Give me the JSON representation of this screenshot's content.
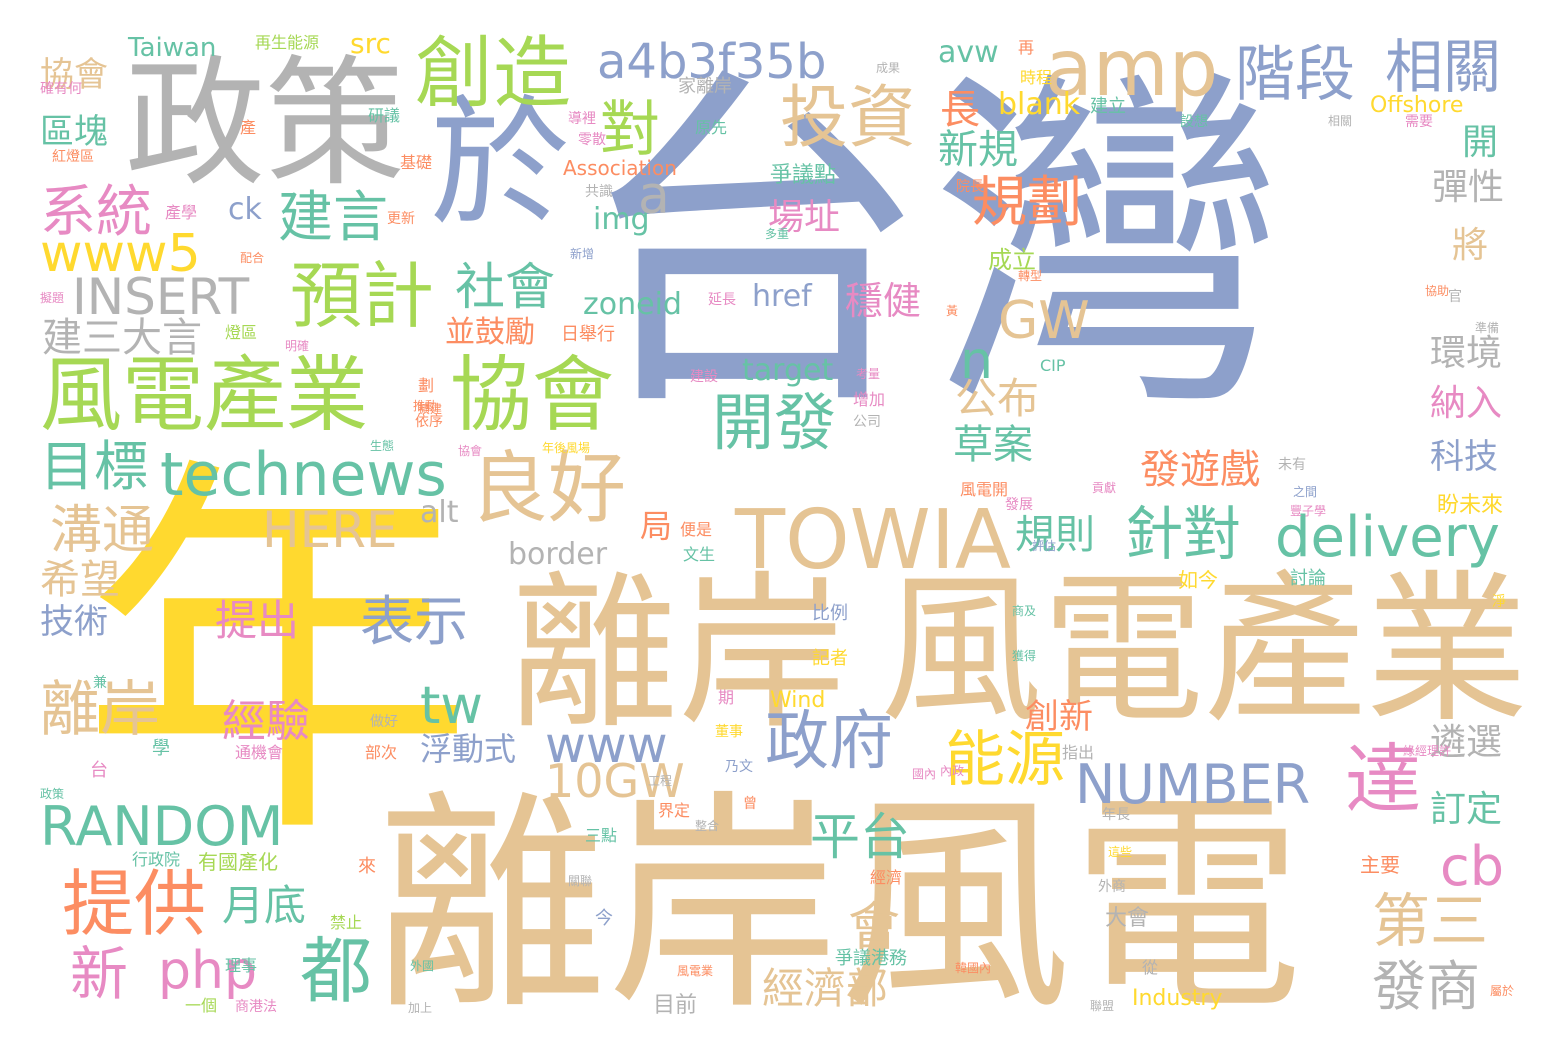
{
  "colors": {
    "background": "#ffffff",
    "yellow": "#ffd92f",
    "tan": "#e5c494",
    "blue": "#8da0cb",
    "gray": "#b3b3b3",
    "green": "#a6d854",
    "teal": "#66c2a5",
    "orange": "#fc8d62",
    "pink": "#e78ac3"
  },
  "words": [
    {
      "text": "台灣",
      "color": "blue"
    },
    {
      "text": "年",
      "color": "yellow"
    },
    {
      "text": "離岸風電",
      "color": "tan"
    },
    {
      "text": "離岸",
      "color": "tan"
    },
    {
      "text": "風電產業",
      "color": "tan"
    },
    {
      "text": "政策",
      "color": "gray"
    },
    {
      "text": "於",
      "color": "blue"
    },
    {
      "text": "創造",
      "color": "green"
    },
    {
      "text": "a4b3f35b",
      "color": "blue"
    },
    {
      "text": "amp",
      "color": "tan"
    },
    {
      "text": "階段",
      "color": "blue"
    },
    {
      "text": "相關",
      "color": "blue"
    },
    {
      "text": "投資",
      "color": "tan"
    },
    {
      "text": "對",
      "color": "green"
    },
    {
      "text": "長",
      "color": "orange"
    },
    {
      "text": "新規",
      "color": "teal"
    },
    {
      "text": "規劃",
      "color": "orange"
    },
    {
      "text": "系統",
      "color": "pink"
    },
    {
      "text": "建言",
      "color": "teal"
    },
    {
      "text": "www5",
      "color": "yellow"
    },
    {
      "text": "INSERT",
      "color": "gray"
    },
    {
      "text": "預計",
      "color": "green"
    },
    {
      "text": "社會",
      "color": "teal"
    },
    {
      "text": "建三大言",
      "color": "gray"
    },
    {
      "text": "風電產業",
      "color": "green"
    },
    {
      "text": "協會",
      "color": "green"
    },
    {
      "text": "目標",
      "color": "teal"
    },
    {
      "text": "technews",
      "color": "teal"
    },
    {
      "text": "良好",
      "color": "tan"
    },
    {
      "text": "開發",
      "color": "teal"
    },
    {
      "text": "HERE",
      "color": "tan"
    },
    {
      "text": "TOWIA",
      "color": "tan"
    },
    {
      "text": "針對",
      "color": "teal"
    },
    {
      "text": "delivery",
      "color": "teal"
    },
    {
      "text": "溝通",
      "color": "tan"
    },
    {
      "text": "希望",
      "color": "tan"
    },
    {
      "text": "提出",
      "color": "pink"
    },
    {
      "text": "表示",
      "color": "blue"
    },
    {
      "text": "技術",
      "color": "blue"
    },
    {
      "text": "離岸",
      "color": "tan"
    },
    {
      "text": "經驗",
      "color": "pink"
    },
    {
      "text": "tw",
      "color": "teal"
    },
    {
      "text": "www",
      "color": "blue"
    },
    {
      "text": "政府",
      "color": "blue"
    },
    {
      "text": "能源",
      "color": "yellow"
    },
    {
      "text": "NUMBER",
      "color": "blue"
    },
    {
      "text": "達",
      "color": "pink"
    },
    {
      "text": "10GW",
      "color": "tan"
    },
    {
      "text": "RANDOM",
      "color": "teal"
    },
    {
      "text": "平台",
      "color": "teal"
    },
    {
      "text": "提供",
      "color": "orange"
    },
    {
      "text": "php",
      "color": "pink"
    },
    {
      "text": "月底",
      "color": "teal"
    },
    {
      "text": "都",
      "color": "teal"
    },
    {
      "text": "新",
      "color": "pink"
    },
    {
      "text": "cb",
      "color": "pink"
    },
    {
      "text": "第三",
      "color": "tan"
    },
    {
      "text": "發商",
      "color": "gray"
    },
    {
      "text": "經濟部",
      "color": "tan"
    },
    {
      "text": "會",
      "color": "tan"
    },
    {
      "text": "GW",
      "color": "tan"
    },
    {
      "text": "n",
      "color": "teal"
    },
    {
      "text": "公布",
      "color": "tan"
    },
    {
      "text": "草案",
      "color": "teal"
    },
    {
      "text": "發遊戲",
      "color": "orange"
    },
    {
      "text": "規則",
      "color": "teal"
    },
    {
      "text": "場址",
      "color": "pink"
    },
    {
      "text": "穩健",
      "color": "pink"
    },
    {
      "text": "blank",
      "color": "yellow"
    },
    {
      "text": "avw",
      "color": "teal"
    },
    {
      "text": "href",
      "color": "blue"
    },
    {
      "text": "zoneid",
      "color": "teal"
    },
    {
      "text": "並鼓勵",
      "color": "orange"
    },
    {
      "text": "img",
      "color": "teal"
    },
    {
      "text": "ck",
      "color": "blue"
    },
    {
      "text": "a",
      "color": "gray"
    },
    {
      "text": "target",
      "color": "teal"
    },
    {
      "text": "border",
      "color": "gray"
    },
    {
      "text": "alt",
      "color": "gray"
    },
    {
      "text": "局",
      "color": "orange"
    },
    {
      "text": "浮動式",
      "color": "blue"
    },
    {
      "text": "Taiwan",
      "color": "teal"
    },
    {
      "text": "src",
      "color": "yellow"
    },
    {
      "text": "協會",
      "color": "tan"
    },
    {
      "text": "區塊",
      "color": "teal"
    },
    {
      "text": "開",
      "color": "teal"
    },
    {
      "text": "彈性",
      "color": "gray"
    },
    {
      "text": "將",
      "color": "tan"
    },
    {
      "text": "環境",
      "color": "gray"
    },
    {
      "text": "納入",
      "color": "pink"
    },
    {
      "text": "科技",
      "color": "blue"
    },
    {
      "text": "遴選",
      "color": "gray"
    },
    {
      "text": "訂定",
      "color": "teal"
    },
    {
      "text": "創新",
      "color": "orange"
    },
    {
      "text": "Offshore",
      "color": "yellow"
    },
    {
      "text": "Association",
      "color": "orange"
    },
    {
      "text": "Industry",
      "color": "yellow"
    },
    {
      "text": "Wind",
      "color": "yellow"
    },
    {
      "text": "成立",
      "color": "green"
    },
    {
      "text": "盼未來",
      "color": "yellow"
    },
    {
      "text": "爭議點",
      "color": "teal"
    },
    {
      "text": "大會",
      "color": "gray"
    },
    {
      "text": "目前",
      "color": "gray"
    },
    {
      "text": "再生能源",
      "color": "green"
    },
    {
      "text": "有國產化",
      "color": "green"
    },
    {
      "text": "行政院",
      "color": "teal"
    },
    {
      "text": "一個",
      "color": "green"
    },
    {
      "text": "爭議港務",
      "color": "teal"
    },
    {
      "text": "經濟",
      "color": "orange"
    },
    {
      "text": "主要",
      "color": "orange"
    },
    {
      "text": "家離岸",
      "color": "gray"
    },
    {
      "text": "建立",
      "color": "teal"
    },
    {
      "text": "時程",
      "color": "yellow"
    },
    {
      "text": "原先",
      "color": "teal"
    },
    {
      "text": "基礎",
      "color": "orange"
    },
    {
      "text": "產學",
      "color": "pink"
    },
    {
      "text": "更新",
      "color": "orange"
    },
    {
      "text": "延長",
      "color": "pink"
    },
    {
      "text": "日舉行",
      "color": "orange"
    },
    {
      "text": "建設",
      "color": "pink"
    },
    {
      "text": "增加",
      "color": "pink"
    },
    {
      "text": "公司",
      "color": "gray"
    },
    {
      "text": "比例",
      "color": "blue"
    },
    {
      "text": "記者",
      "color": "yellow"
    },
    {
      "text": "期",
      "color": "pink"
    },
    {
      "text": "如今",
      "color": "yellow"
    },
    {
      "text": "討論",
      "color": "teal"
    },
    {
      "text": "指出",
      "color": "gray"
    },
    {
      "text": "部次",
      "color": "orange"
    },
    {
      "text": "通機會",
      "color": "pink"
    },
    {
      "text": "三點",
      "color": "teal"
    },
    {
      "text": "界定",
      "color": "orange"
    },
    {
      "text": "禁止",
      "color": "green"
    },
    {
      "text": "理事",
      "color": "teal"
    },
    {
      "text": "從",
      "color": "gray"
    },
    {
      "text": "外商",
      "color": "gray"
    },
    {
      "text": "年長",
      "color": "gray"
    },
    {
      "text": "今",
      "color": "blue"
    },
    {
      "text": "便是",
      "color": "orange"
    },
    {
      "text": "文生",
      "color": "teal"
    },
    {
      "text": "乃文",
      "color": "blue"
    },
    {
      "text": "董事",
      "color": "yellow"
    },
    {
      "text": "做好",
      "color": "gray"
    },
    {
      "text": "發展",
      "color": "pink"
    },
    {
      "text": "風電開",
      "color": "orange"
    },
    {
      "text": "協會",
      "color": "pink"
    },
    {
      "text": "依序",
      "color": "orange"
    },
    {
      "text": "生態",
      "color": "teal"
    },
    {
      "text": "燈區",
      "color": "green"
    },
    {
      "text": "紅燈區",
      "color": "orange"
    },
    {
      "text": "研議",
      "color": "teal"
    },
    {
      "text": "導裡",
      "color": "pink"
    },
    {
      "text": "零散",
      "color": "pink"
    },
    {
      "text": "設想",
      "color": "teal"
    },
    {
      "text": "需要",
      "color": "pink"
    },
    {
      "text": "院長",
      "color": "orange"
    },
    {
      "text": "轉型",
      "color": "orange"
    },
    {
      "text": "黃",
      "color": "orange"
    },
    {
      "text": "準備",
      "color": "gray"
    },
    {
      "text": "官",
      "color": "gray"
    },
    {
      "text": "未有",
      "color": "gray"
    },
    {
      "text": "之間",
      "color": "blue"
    },
    {
      "text": "綠經理許",
      "color": "pink"
    },
    {
      "text": "淨",
      "color": "yellow"
    },
    {
      "text": "來",
      "color": "orange"
    },
    {
      "text": "台",
      "color": "pink"
    },
    {
      "text": "學",
      "color": "teal"
    },
    {
      "text": "兼",
      "color": "teal"
    },
    {
      "text": "產",
      "color": "orange"
    },
    {
      "text": "劃",
      "color": "orange"
    },
    {
      "text": "再",
      "color": "orange"
    },
    {
      "text": "CIP",
      "color": "teal"
    },
    {
      "text": "曾",
      "color": "orange"
    },
    {
      "text": "年後風場",
      "color": "yellow"
    },
    {
      "text": "這些",
      "color": "yellow"
    },
    {
      "text": "關聯",
      "color": "gray"
    },
    {
      "text": "成果",
      "color": "gray"
    },
    {
      "text": "考量",
      "color": "pink"
    },
    {
      "text": "擬題",
      "color": "pink"
    },
    {
      "text": "多重",
      "color": "teal"
    },
    {
      "text": "確有何",
      "color": "pink"
    },
    {
      "text": "配合",
      "color": "orange"
    },
    {
      "text": "新增",
      "color": "blue"
    },
    {
      "text": "共識",
      "color": "gray"
    },
    {
      "text": "評估",
      "color": "blue"
    },
    {
      "text": "擴建",
      "color": "orange"
    },
    {
      "text": "商港法",
      "color": "pink"
    },
    {
      "text": "相關",
      "color": "gray"
    },
    {
      "text": "明確",
      "color": "pink"
    },
    {
      "text": "貢獻",
      "color": "pink"
    },
    {
      "text": "風電業",
      "color": "orange"
    },
    {
      "text": "國內",
      "color": "pink"
    },
    {
      "text": "商及",
      "color": "teal"
    },
    {
      "text": "獲得",
      "color": "teal"
    },
    {
      "text": "屬於",
      "color": "orange"
    },
    {
      "text": "政策",
      "color": "teal"
    },
    {
      "text": "工程",
      "color": "gray"
    },
    {
      "text": "加上",
      "color": "gray"
    },
    {
      "text": "韓國內",
      "color": "orange"
    },
    {
      "text": "內政",
      "color": "pink"
    },
    {
      "text": "豐子學",
      "color": "pink"
    },
    {
      "text": "推動",
      "color": "orange"
    },
    {
      "text": "整合",
      "color": "gray"
    },
    {
      "text": "協助",
      "color": "orange"
    },
    {
      "text": "聯盟",
      "color": "gray"
    },
    {
      "text": "外國",
      "color": "teal"
    }
  ]
}
